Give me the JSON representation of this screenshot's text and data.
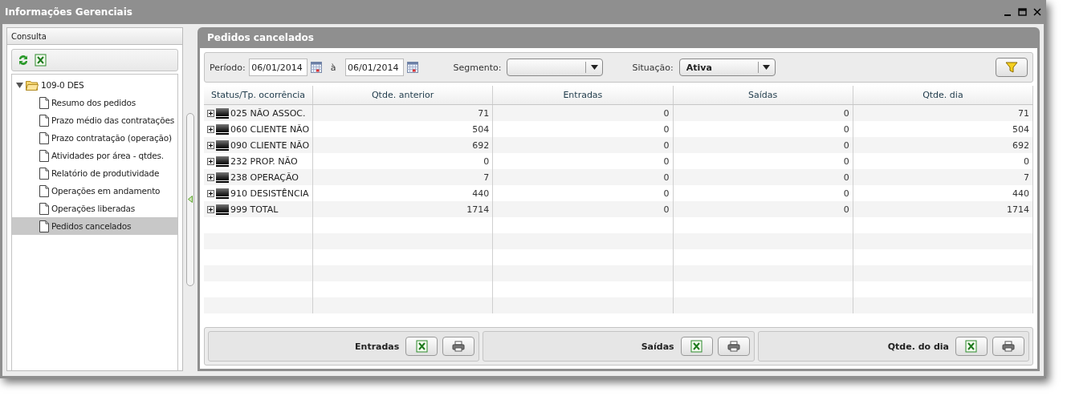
{
  "window": {
    "title": "Informações Gerenciais"
  },
  "sidebar": {
    "title": "Consulta",
    "tree": [
      {
        "label": "109-0 DES",
        "expanded": true,
        "selected": false,
        "children": [
          {
            "label": "Resumo dos pedidos",
            "selected": false
          },
          {
            "label": "Prazo médio das contratações",
            "selected": false
          },
          {
            "label": "Prazo contratação (operação)",
            "selected": false
          },
          {
            "label": "Atividades por área - qtdes.",
            "selected": false
          },
          {
            "label": "Relatório de produtividade",
            "selected": false
          },
          {
            "label": "Operações em andamento",
            "selected": false
          },
          {
            "label": "Operações liberadas",
            "selected": false
          },
          {
            "label": "Pedidos cancelados",
            "selected": true
          }
        ]
      }
    ]
  },
  "main": {
    "title": "Pedidos cancelados",
    "filters": {
      "period_label": "Período:",
      "date_from": "06/01/2014",
      "between": "à",
      "date_to": "06/01/2014",
      "segment_label": "Segmento:",
      "situation_label": "Situação:",
      "situation_value": "Ativa"
    },
    "table": {
      "columns": [
        "Status/Tp. ocorrência",
        "Qtde. anterior",
        "Entradas",
        "Saídas",
        "Qtde. dia"
      ],
      "rows": [
        {
          "expanded": false,
          "cells": [
            "025 NÃO ASSOC.",
            "71",
            "0",
            "0",
            "71"
          ]
        },
        {
          "expanded": false,
          "cells": [
            "060 CLIENTE NÃO",
            "504",
            "0",
            "0",
            "504"
          ]
        },
        {
          "expanded": false,
          "cells": [
            "090 CLIENTE NÃO",
            "692",
            "0",
            "0",
            "692"
          ]
        },
        {
          "expanded": false,
          "cells": [
            "232 PROP. NÃO",
            "0",
            "0",
            "0",
            "0"
          ]
        },
        {
          "expanded": false,
          "cells": [
            "238 OPERAÇÃO",
            "7",
            "0",
            "0",
            "7"
          ]
        },
        {
          "expanded": false,
          "cells": [
            "910 DESISTÊNCIA",
            "440",
            "0",
            "0",
            "440"
          ]
        },
        {
          "expanded": false,
          "cells": [
            "999 TOTAL",
            "1714",
            "0",
            "0",
            "1714"
          ]
        }
      ]
    },
    "exports": [
      {
        "label": "Entradas"
      },
      {
        "label": "Saídas"
      },
      {
        "label": "Qtde. do dia"
      }
    ]
  }
}
